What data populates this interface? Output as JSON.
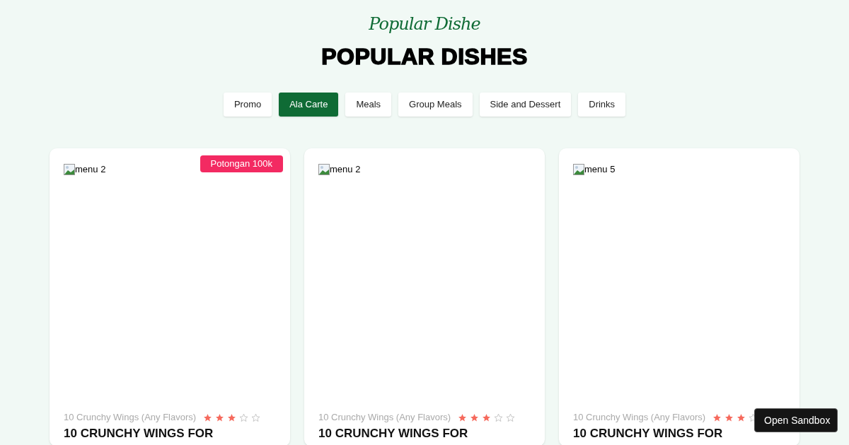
{
  "header": {
    "script_title": "Popular Dishe",
    "title": "POPULAR DISHES"
  },
  "tabs": [
    {
      "label": "Promo",
      "selected": false
    },
    {
      "label": "Ala Carte",
      "selected": true
    },
    {
      "label": "Meals",
      "selected": false
    },
    {
      "label": "Group Meals",
      "selected": false
    },
    {
      "label": "Side and Dessert",
      "selected": false
    },
    {
      "label": "Drinks",
      "selected": false
    }
  ],
  "cards": [
    {
      "image_alt": "menu 2",
      "badge": "Potongan 100k",
      "subtitle": "10 Crunchy Wings (Any Flavors)",
      "stars": 3,
      "title": "10 CRUNCHY WINGS FOR"
    },
    {
      "image_alt": "menu 2",
      "subtitle": "10 Crunchy Wings (Any Flavors)",
      "stars": 3,
      "title": "10 CRUNCHY WINGS FOR"
    },
    {
      "image_alt": "menu 5",
      "subtitle": "10 Crunchy Wings (Any Flavors)",
      "stars": 3,
      "title": "10 CRUNCHY WINGS FOR"
    }
  ],
  "sandbox_button": {
    "label": "Open Sandbox"
  }
}
